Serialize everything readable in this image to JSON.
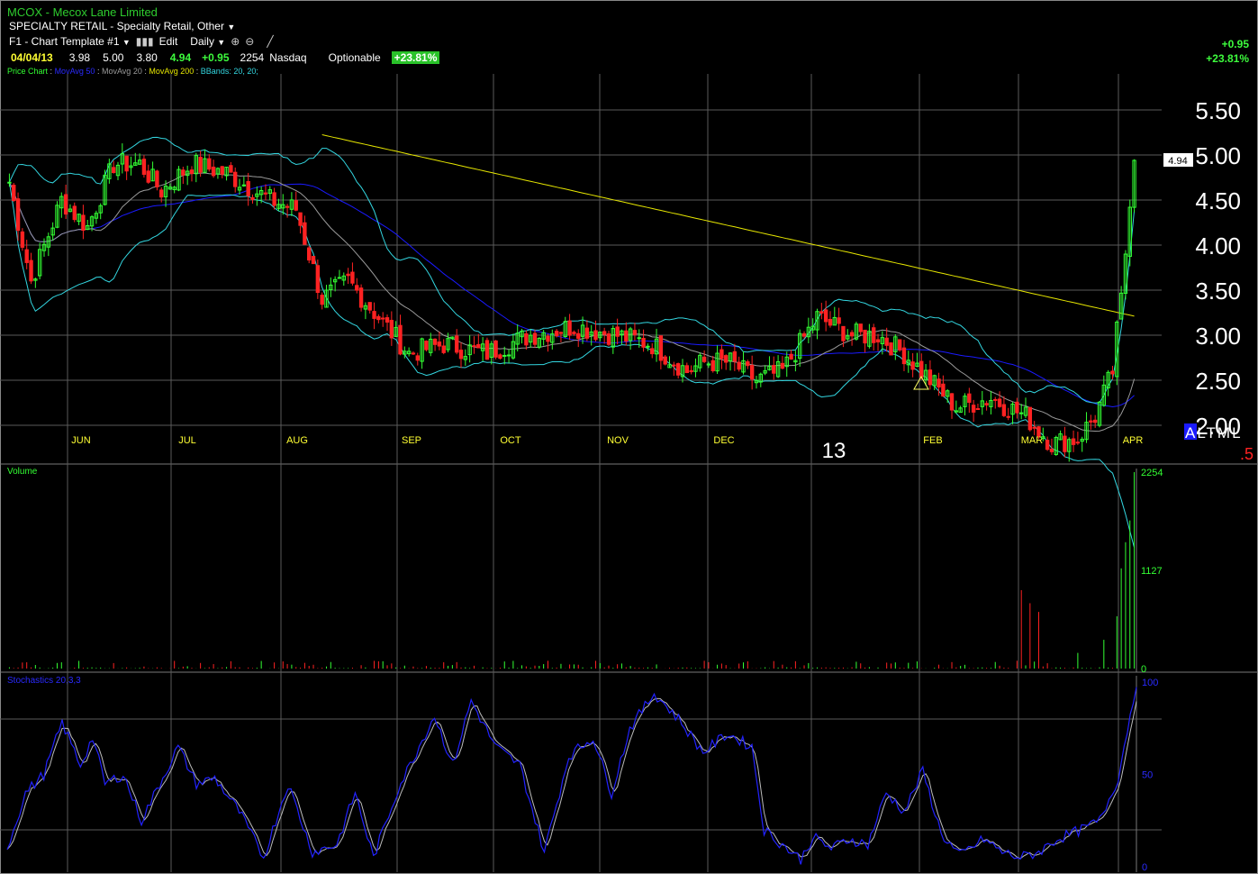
{
  "header": {
    "ticker": "MCOX",
    "company": "Mecox Lane Limited",
    "sector": "SPECIALTY RETAIL - Specialty Retail, Other",
    "template": "F1 - Chart Template #1",
    "edit_label": "Edit",
    "period": "Daily",
    "quote": {
      "date": "04/04/13",
      "open": "3.98",
      "high": "5.00",
      "low": "3.80",
      "close": "4.94",
      "change": "+0.95",
      "volume": "2254",
      "exchange": "Nasdaq",
      "optionable": "Optionable",
      "pct": "+23.81%"
    },
    "change_right": "+0.95",
    "pct_right": "+23.81%"
  },
  "legend": {
    "price_chart": "Price Chart",
    "mavg50": "MovAvg 50",
    "mavg20": "MovAvg 20",
    "mavg200": "MovAvg 200",
    "bbands": "BBands: 20, 20;"
  },
  "colors": {
    "up": "#33ff33",
    "down": "#ff2222",
    "ma50": "#1a1aff",
    "ma20": "#9a9a9a",
    "ma200": "#e6e600",
    "bbands": "#33d6e0",
    "grid": "#5a5a5a",
    "stoch": "#2222ff",
    "stoch_signal": "#bbbbbb",
    "month": "#ffff33"
  },
  "price_labels": {
    "last": "4.94",
    "year": "13",
    "altml": "ALTML",
    "altml_sub": ".5"
  },
  "panels": {
    "volume_title": "Volume",
    "stoch_title": "Stochastics 20,3,3"
  },
  "chart_data": [
    {
      "type": "candlestick",
      "title": "Price Chart",
      "x_months": [
        "JUN",
        "JUL",
        "AUG",
        "SEP",
        "OCT",
        "NOV",
        "DEC",
        "FEB",
        "MAR",
        "APR"
      ],
      "y_ticks": [
        "5.50",
        "5.00",
        "4.50",
        "4.00",
        "3.50",
        "3.00",
        "2.50",
        "2.00"
      ],
      "ylim": [
        1.6,
        5.9
      ],
      "close_anchors": [
        [
          0,
          4.7
        ],
        [
          5,
          3.6
        ],
        [
          12,
          4.5
        ],
        [
          18,
          4.2
        ],
        [
          24,
          4.9
        ],
        [
          30,
          4.9
        ],
        [
          35,
          4.6
        ],
        [
          42,
          4.9
        ],
        [
          50,
          4.8
        ],
        [
          60,
          4.5
        ],
        [
          66,
          4.4
        ],
        [
          72,
          3.4
        ],
        [
          78,
          3.6
        ],
        [
          85,
          3.2
        ],
        [
          92,
          2.8
        ],
        [
          100,
          2.9
        ],
        [
          110,
          2.8
        ],
        [
          120,
          3.0
        ],
        [
          130,
          3.1
        ],
        [
          140,
          3.0
        ],
        [
          148,
          2.9
        ],
        [
          156,
          2.6
        ],
        [
          160,
          2.7
        ],
        [
          166,
          2.7
        ],
        [
          172,
          2.5
        ],
        [
          178,
          2.6
        ],
        [
          186,
          3.2
        ],
        [
          194,
          3.0
        ],
        [
          200,
          3.0
        ],
        [
          206,
          2.8
        ],
        [
          212,
          2.5
        ],
        [
          218,
          2.2
        ],
        [
          226,
          2.3
        ],
        [
          234,
          2.1
        ],
        [
          240,
          1.8
        ],
        [
          246,
          1.85
        ],
        [
          250,
          2.1
        ],
        [
          254,
          2.6
        ],
        [
          257,
          3.9
        ],
        [
          259,
          4.94
        ]
      ],
      "bars": 260,
      "last_close": 4.94,
      "series": [
        {
          "name": "MovAvg 200"
        },
        {
          "name": "MovAvg 50"
        },
        {
          "name": "MovAvg 20"
        },
        {
          "name": "BBands: 20, 20;"
        }
      ]
    },
    {
      "type": "bar",
      "title": "Volume",
      "y_ticks": [
        "2254",
        "1127",
        "0"
      ],
      "ylim": [
        0,
        2254
      ],
      "spikes": [
        [
          233,
          900
        ],
        [
          235,
          750
        ],
        [
          237,
          650
        ],
        [
          246,
          180
        ],
        [
          252,
          330
        ],
        [
          255,
          600
        ],
        [
          256,
          1150
        ],
        [
          257,
          1450
        ],
        [
          258,
          1700
        ],
        [
          259,
          2254
        ]
      ]
    },
    {
      "type": "line",
      "title": "Stochastics 20,3,3",
      "y_ticks": [
        "100",
        "50",
        "0"
      ],
      "ylim": [
        0,
        100
      ],
      "k_anchors": [
        [
          0,
          10
        ],
        [
          6,
          40
        ],
        [
          12,
          50
        ],
        [
          18,
          78
        ],
        [
          24,
          55
        ],
        [
          28,
          70
        ],
        [
          32,
          45
        ],
        [
          38,
          50
        ],
        [
          44,
          25
        ],
        [
          50,
          45
        ],
        [
          56,
          65
        ],
        [
          62,
          45
        ],
        [
          68,
          48
        ],
        [
          76,
          30
        ],
        [
          84,
          5
        ],
        [
          92,
          45
        ],
        [
          100,
          8
        ],
        [
          108,
          12
        ],
        [
          114,
          40
        ],
        [
          120,
          5
        ],
        [
          128,
          42
        ],
        [
          134,
          62
        ],
        [
          140,
          82
        ],
        [
          146,
          55
        ],
        [
          152,
          90
        ],
        [
          160,
          65
        ],
        [
          168,
          55
        ],
        [
          176,
          8
        ],
        [
          184,
          60
        ],
        [
          192,
          70
        ],
        [
          198,
          40
        ],
        [
          204,
          75
        ],
        [
          212,
          94
        ],
        [
          220,
          80
        ],
        [
          228,
          62
        ],
        [
          236,
          72
        ],
        [
          244,
          65
        ],
        [
          248,
          20
        ],
        [
          254,
          12
        ],
        [
          260,
          4
        ],
        [
          264,
          16
        ],
        [
          270,
          10
        ],
        [
          276,
          15
        ],
        [
          282,
          12
        ],
        [
          288,
          40
        ],
        [
          294,
          30
        ],
        [
          300,
          52
        ],
        [
          306,
          18
        ],
        [
          312,
          6
        ],
        [
          320,
          15
        ],
        [
          326,
          8
        ],
        [
          332,
          5
        ],
        [
          338,
          8
        ],
        [
          344,
          15
        ],
        [
          352,
          20
        ],
        [
          358,
          25
        ],
        [
          364,
          48
        ],
        [
          370,
          100
        ]
      ],
      "k_points": 371
    }
  ]
}
